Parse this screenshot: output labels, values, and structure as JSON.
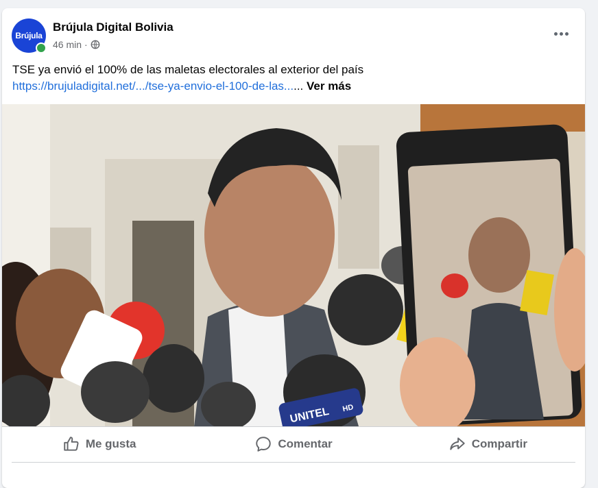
{
  "post": {
    "page_name": "Brújula Digital Bolivia",
    "avatar_text": "Brújula",
    "time": "46 min",
    "separator": "·",
    "headline": "TSE ya envió el 100% de las maletas electorales al exterior del país",
    "link": "https://brujuladigital.net/.../tse-ya-envio-el-100-de-las...",
    "ellipsis": "...",
    "see_more": "Ver más",
    "mic_brand": "UNITEL",
    "mic_hd": "HD"
  },
  "actions": {
    "like": "Me gusta",
    "comment": "Comentar",
    "share": "Compartir"
  },
  "colors": {
    "accent": "#216fdb",
    "online": "#31a24c",
    "brand": "#1a44d6"
  }
}
